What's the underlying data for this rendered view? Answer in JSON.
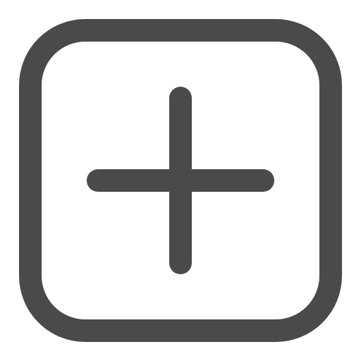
{
  "icon": {
    "name": "add-square-icon",
    "frame": "rounded-square",
    "glyph": "plus",
    "stroke_color": "#4a4a4a",
    "background_color": "#ffffff"
  }
}
